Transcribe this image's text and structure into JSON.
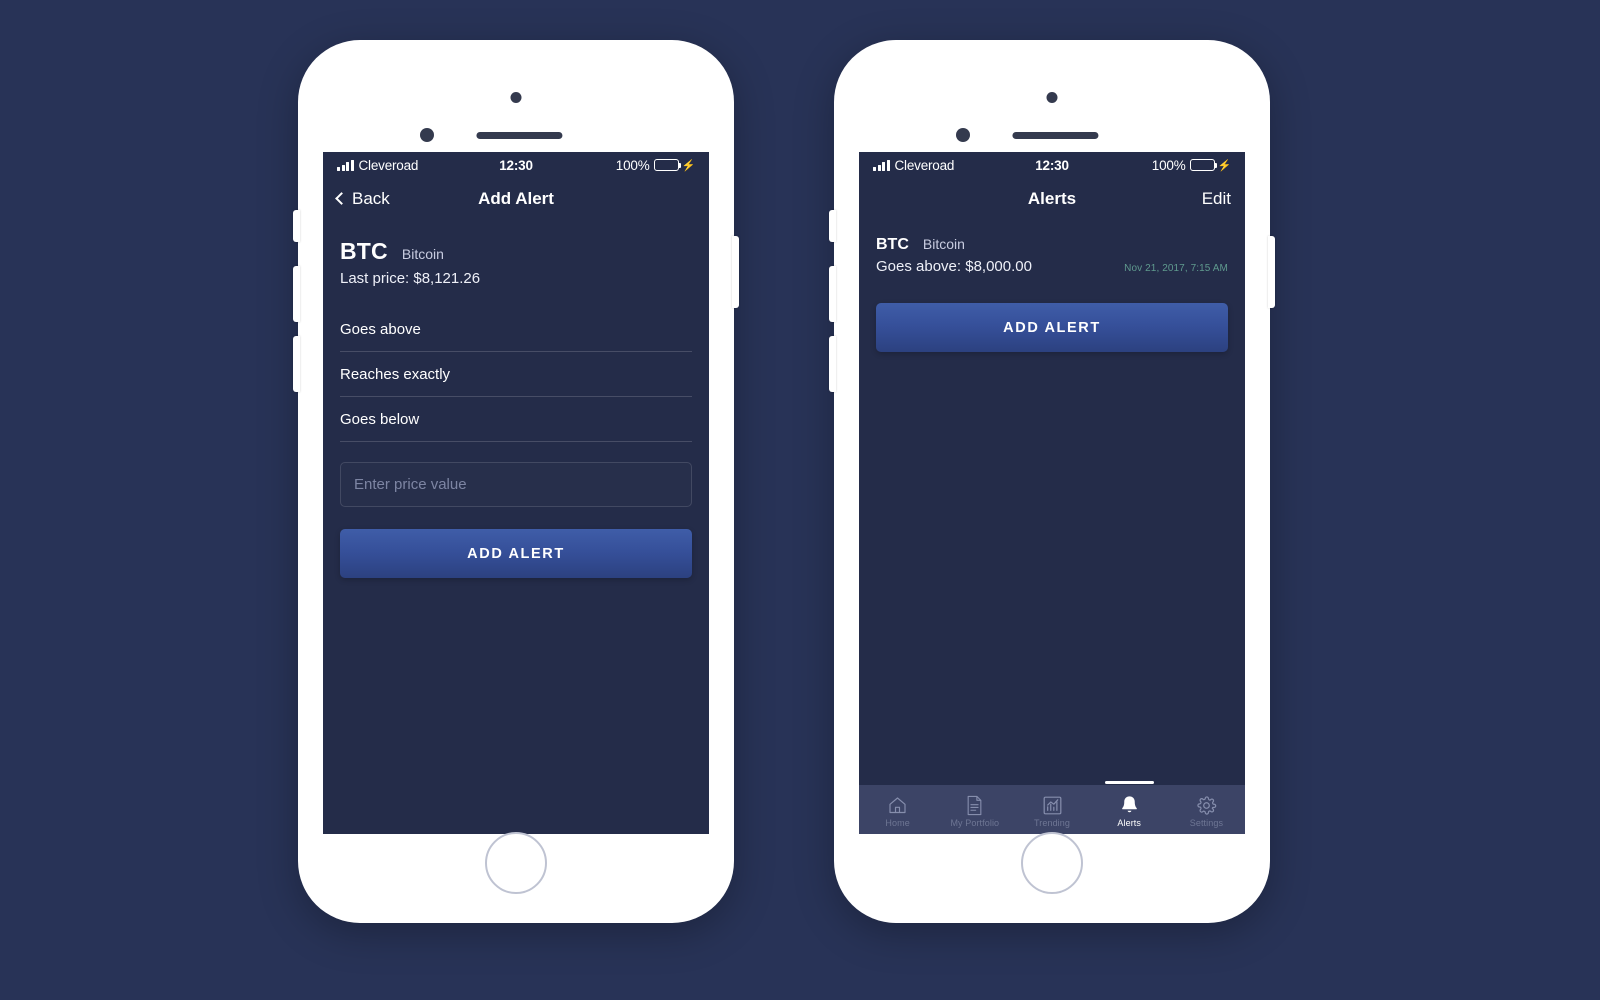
{
  "theme": {
    "page_background": "#283357",
    "screen_background": "#242c49",
    "accent_button": "#36509a",
    "tabbar_background": "#3c4466",
    "battery_green": "#3ddc62",
    "date_teal": "#5f9a8e"
  },
  "status_bar": {
    "carrier": "Cleveroad",
    "time": "12:30",
    "battery_percent": "100%",
    "signal_icon": "signal-bars-icon",
    "battery_icon": "battery-full-icon",
    "charging_icon": "lightning-bolt-icon"
  },
  "add_alert_screen": {
    "nav": {
      "back_label": "Back",
      "back_icon": "chevron-left-icon",
      "title": "Add Alert"
    },
    "coin": {
      "symbol": "BTC",
      "name": "Bitcoin",
      "last_price_label": "Last price: $8,121.26"
    },
    "conditions": [
      {
        "label": "Goes above"
      },
      {
        "label": "Reaches exactly"
      },
      {
        "label": "Goes below"
      }
    ],
    "price_input": {
      "value": "",
      "placeholder": "Enter price value"
    },
    "submit_label": "ADD ALERT"
  },
  "alerts_screen": {
    "nav": {
      "title": "Alerts",
      "edit_label": "Edit"
    },
    "alerts": [
      {
        "symbol": "BTC",
        "name": "Bitcoin",
        "condition": "Goes above: $8,000.00",
        "date": "Nov 21, 2017, 7:15 AM"
      }
    ],
    "add_alert_label": "ADD ALERT",
    "tabs": [
      {
        "label": "Home",
        "icon": "home-icon",
        "active": false
      },
      {
        "label": "My Portfolio",
        "icon": "document-icon",
        "active": false
      },
      {
        "label": "Trending",
        "icon": "bar-chart-icon",
        "active": false
      },
      {
        "label": "Alerts",
        "icon": "bell-icon",
        "active": true
      },
      {
        "label": "Settings",
        "icon": "gear-icon",
        "active": false
      }
    ]
  }
}
